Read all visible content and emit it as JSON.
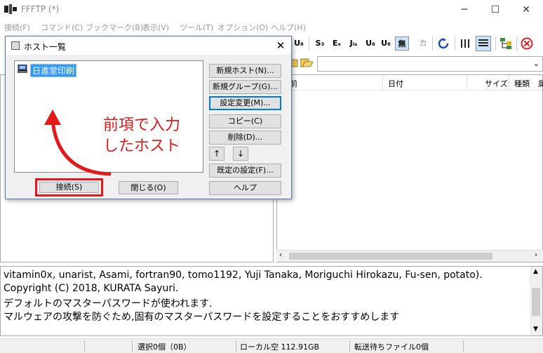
{
  "window": {
    "title": "FFFTP (*)",
    "min": "─",
    "max": "☐",
    "close": "✕"
  },
  "menu": [
    "接続(F)",
    "コマンド(C)",
    "ブックマーク(B)",
    "表示(V)",
    "ツール(T)",
    "オプション(O)",
    "ヘルプ(H)"
  ],
  "toolbar": {
    "items": [
      "U₈",
      "S₃",
      "Eₓ",
      "Jᵢₛ",
      "U₈",
      "U₈",
      "無",
      "カ"
    ]
  },
  "remote": {
    "path": "",
    "columns": [
      "前",
      "日付",
      "サイズ",
      "種類",
      "属"
    ]
  },
  "log": {
    "lines": [
      "vitamin0x, unarist, Asami, fortran90, tomo1192, Yuji Tanaka, Moriguchi Hirokazu, Fu-sen, potato).",
      "Copyright (C) 2018, KURATA Sayuri.",
      "デフォルトのマスターパスワードが使われます.",
      "マルウェアの攻撃を防ぐため,固有のマスターパスワードを設定することをおすすめします"
    ]
  },
  "status": {
    "selection": "選択0個（0B）",
    "local_free": "ローカル空 112.91GB",
    "queue": "転送待ちファイル0個"
  },
  "dialog": {
    "title": "ホスト一覧",
    "close": "✕",
    "hosts": [
      "日進堂印刷"
    ],
    "buttons": {
      "new_host": "新規ホスト(N)...",
      "new_group": "新規グループ(G)...",
      "edit": "設定変更(M)...",
      "copy": "コピー(C)",
      "delete": "削除(D)...",
      "up": "↑",
      "down": "↓",
      "default_settings": "既定の設定(F)...",
      "help": "ヘルプ",
      "connect": "接続(S)",
      "close": "閉じる(O)"
    }
  },
  "annotation": {
    "text": "前項で入力\nしたホスト",
    "color": "#e21a1a"
  }
}
